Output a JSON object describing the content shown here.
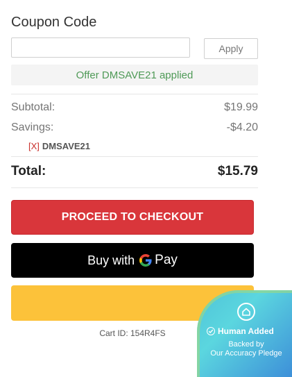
{
  "coupon": {
    "title": "Coupon Code",
    "input_value": "",
    "input_placeholder": "",
    "apply_label": "Apply",
    "offer_message": "Offer DMSAVE21 applied"
  },
  "summary": {
    "subtotal_label": "Subtotal:",
    "subtotal_value": "$19.99",
    "savings_label": "Savings:",
    "savings_value": "-$4.20",
    "remove_label": "[X]",
    "applied_code": "DMSAVE21",
    "total_label": "Total:",
    "total_value": "$15.79"
  },
  "actions": {
    "checkout_label": "PROCEED TO CHECKOUT",
    "gpay_prefix": "Buy with",
    "gpay_g": "G",
    "gpay_pay": "Pay"
  },
  "cart": {
    "id_text": "Cart ID: 154R4FS"
  },
  "badge": {
    "title": "Human Added",
    "line1": "Backed by",
    "line2": "Our Accuracy Pledge"
  },
  "colors": {
    "checkout_bg": "#d9363b",
    "gpay_bg": "#000000",
    "paypal_bg": "#fcc23a",
    "offer_text": "#4f9a57",
    "remove_x": "#c9302c"
  }
}
